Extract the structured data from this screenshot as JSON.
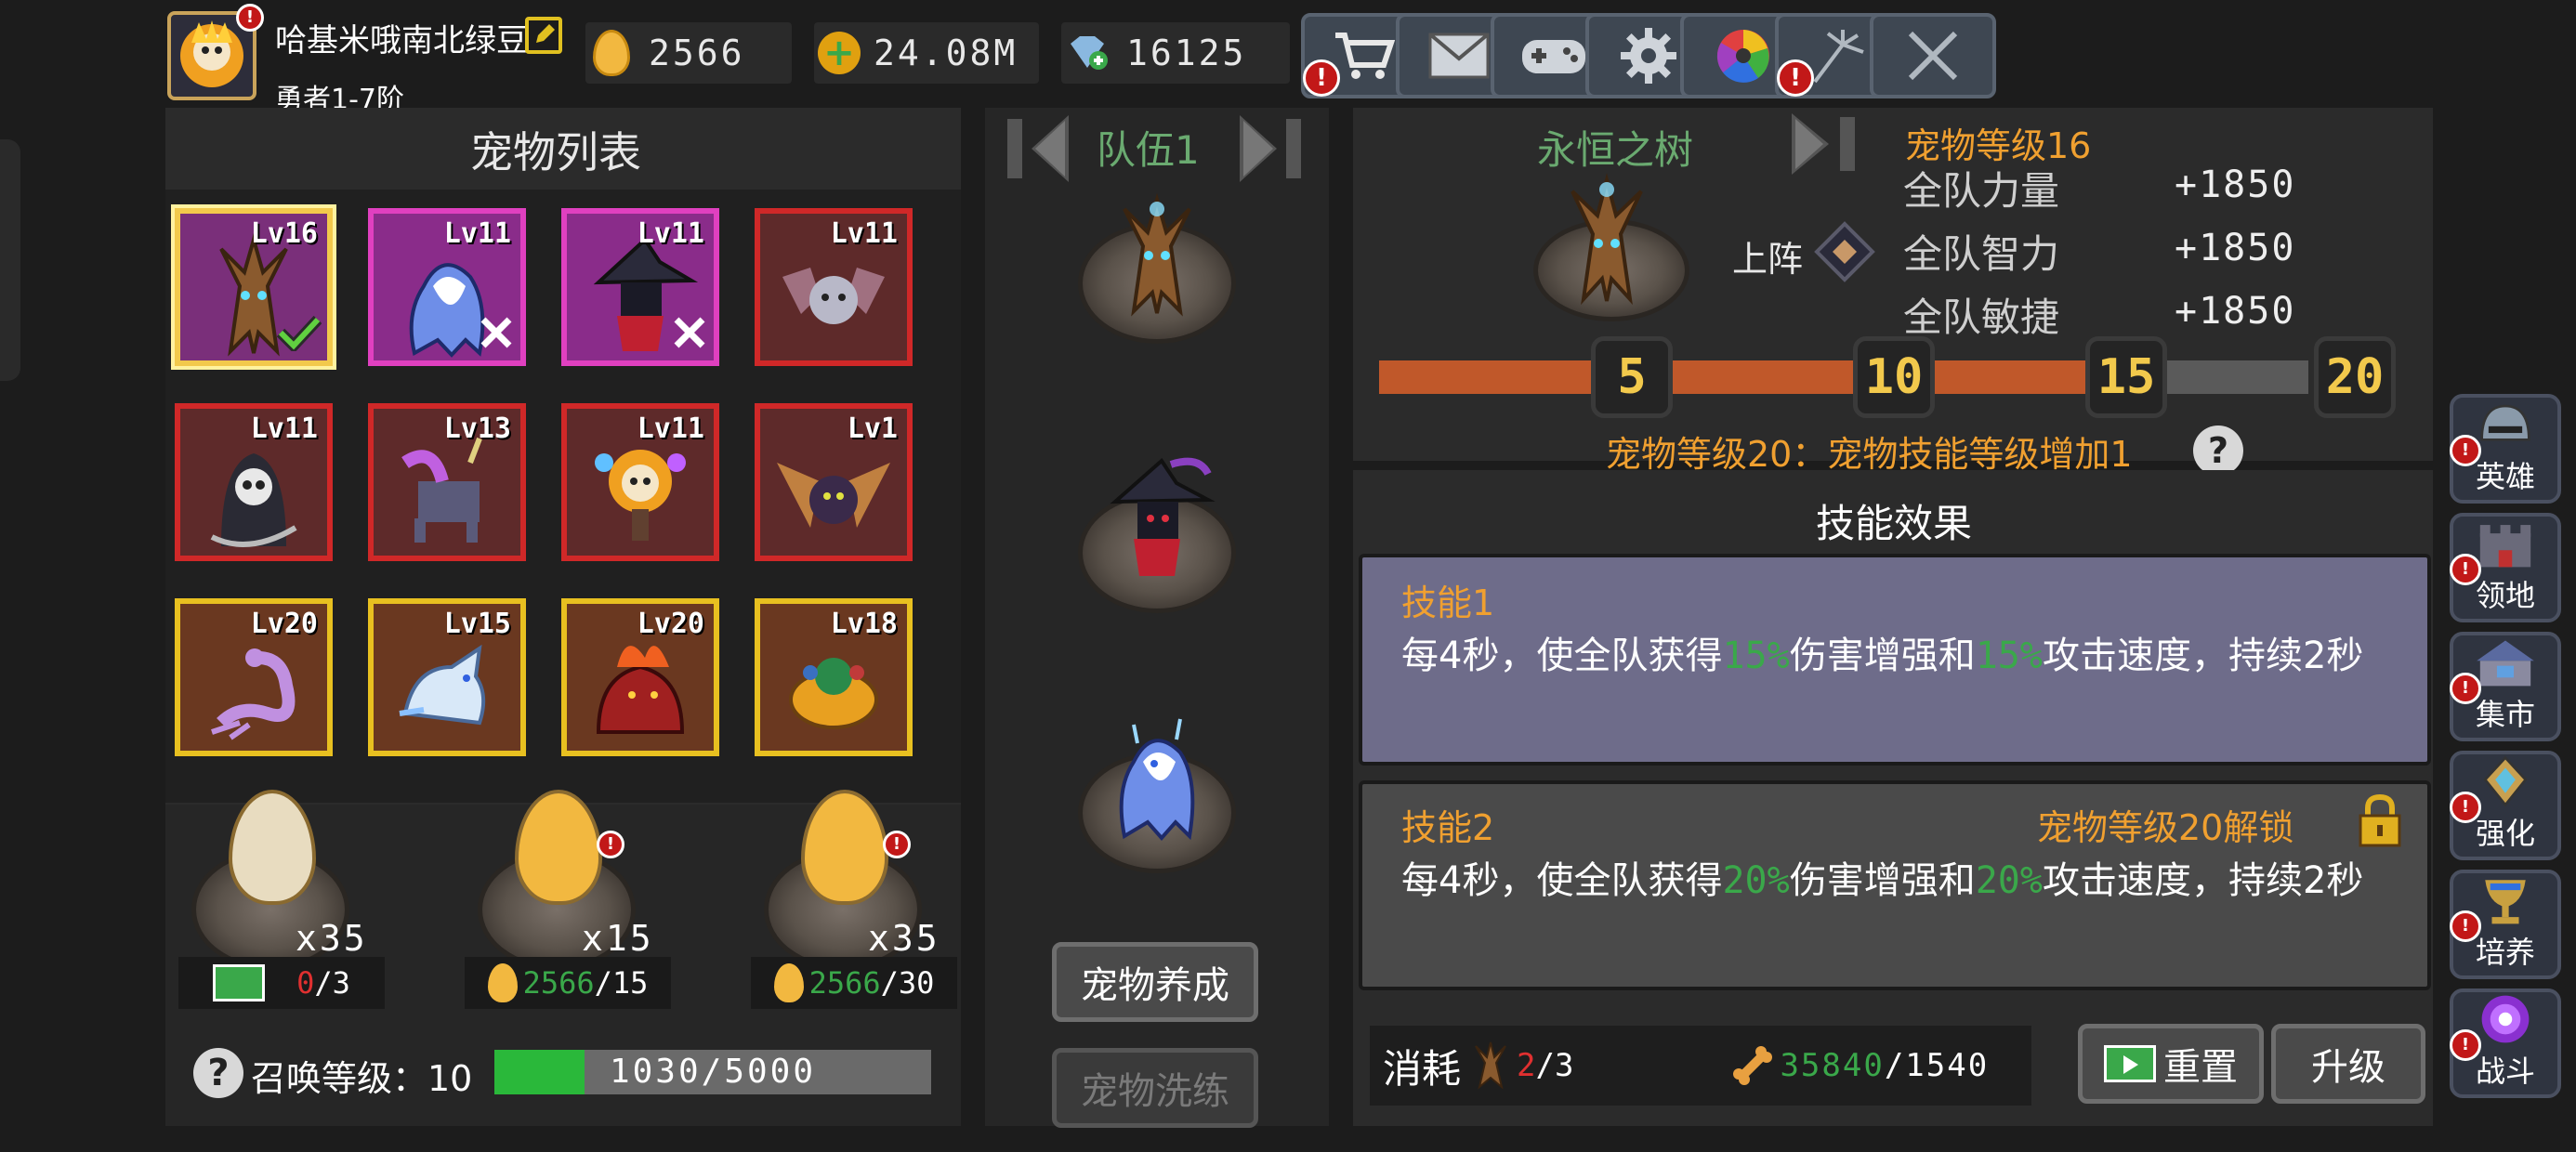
{
  "player": {
    "name": "哈基米哦南北绿豆",
    "rank": "勇者1-7阶",
    "avatar_alert": "!"
  },
  "resources": [
    {
      "name": "gold-egg-icon",
      "value": "2566"
    },
    {
      "name": "coin-plus-icon",
      "value": "24.08M"
    },
    {
      "name": "diamond-plus-icon",
      "value": "16125"
    }
  ],
  "toolbar": [
    {
      "name": "shop-cart-icon",
      "alert": true
    },
    {
      "name": "mail-icon",
      "alert": false
    },
    {
      "name": "gamepad-icon",
      "alert": false
    },
    {
      "name": "gear-icon",
      "alert": false
    },
    {
      "name": "color-wheel-icon",
      "alert": false
    },
    {
      "name": "fireworks-icon",
      "alert": true
    },
    {
      "name": "crossed-swords-icon",
      "alert": false
    }
  ],
  "pet_list": {
    "title": "宠物列表",
    "pets": [
      {
        "lvl": "Lv16",
        "frame": "gold",
        "bg": "#7a2f7a",
        "kind": "tree"
      },
      {
        "lvl": "Lv11",
        "frame": "pink",
        "bg": "#8a2c8a",
        "kind": "ghost"
      },
      {
        "lvl": "Lv11",
        "frame": "pink",
        "bg": "#8a2c8a",
        "kind": "witch"
      },
      {
        "lvl": "Lv11",
        "frame": "red",
        "bg": "#5e2a2a",
        "kind": "bat"
      },
      {
        "lvl": "Lv11",
        "frame": "red",
        "bg": "#5e2a2a",
        "kind": "reaper"
      },
      {
        "lvl": "Lv13",
        "frame": "red",
        "bg": "#5e2a2a",
        "kind": "unicorn"
      },
      {
        "lvl": "Lv11",
        "frame": "red",
        "bg": "#5e2a2a",
        "kind": "skull"
      },
      {
        "lvl": "Lv1",
        "frame": "red",
        "bg": "#5e2a2a",
        "kind": "dragonbat"
      },
      {
        "lvl": "Lv20",
        "frame": "yellow",
        "bg": "#6a3820",
        "kind": "scorpion"
      },
      {
        "lvl": "Lv15",
        "frame": "yellow",
        "bg": "#6a3820",
        "kind": "wolf"
      },
      {
        "lvl": "Lv20",
        "frame": "yellow",
        "bg": "#6a3820",
        "kind": "lava"
      },
      {
        "lvl": "Lv18",
        "frame": "yellow",
        "bg": "#6a3820",
        "kind": "turtle"
      }
    ]
  },
  "summon": {
    "eggs": [
      {
        "count": "x35",
        "cost_have": "0",
        "cost_need": "/3",
        "cost_icon": "ad-video-icon",
        "have_color": "#e03030",
        "alert": false,
        "egg_color": "#e8dcc0"
      },
      {
        "count": "x15",
        "cost_have": "2566",
        "cost_need": "/15",
        "cost_icon": "gold-egg-icon",
        "have_color": "#3aa84a",
        "alert": true,
        "egg_color": "#f2b840"
      },
      {
        "count": "x35",
        "cost_have": "2566",
        "cost_need": "/30",
        "cost_icon": "gold-egg-icon",
        "have_color": "#3aa84a",
        "alert": true,
        "egg_color": "#f2b840"
      }
    ],
    "level_label": "召唤等级：10",
    "progress_text": "1030/5000",
    "progress_fraction": 0.206
  },
  "team": {
    "label": "队伍1",
    "buttons": {
      "nurture": "宠物养成",
      "reroll": "宠物洗练"
    }
  },
  "detail": {
    "pet_name": "永恒之树",
    "deploy_label": "上阵",
    "level_label": "宠物等级16",
    "stats": [
      {
        "name": "全队力量",
        "value": "+1850"
      },
      {
        "name": "全队智力",
        "value": "+1850"
      },
      {
        "name": "全队敏捷",
        "value": "+1850"
      }
    ],
    "milestones": [
      "5",
      "10",
      "15",
      "20"
    ],
    "level_progress": 0.8,
    "milestone_note": "宠物等级20：宠物技能等级增加1",
    "skills_title": "技能效果",
    "skills": [
      {
        "title": "技能1",
        "p1": "每4秒，使全队获得",
        "v1": "15%",
        "p2": "伤害增强和",
        "v2": "15%",
        "p3": "攻击速度，持续2秒",
        "unlock": ""
      },
      {
        "title": "技能2",
        "p1": "每4秒，使全队获得",
        "v1": "20%",
        "p2": "伤害增强和",
        "v2": "20%",
        "p3": "攻击速度，持续2秒",
        "unlock": "宠物等级20解锁"
      }
    ],
    "cost_label": "消耗",
    "cost_pets_have": "2",
    "cost_pets_need": "/3",
    "cost_bones_have": "35840",
    "cost_bones_need": "/1540",
    "reset_label": "重置",
    "upgrade_label": "升级"
  },
  "sidebar": [
    {
      "label": "英雄",
      "icon": "helmet-icon"
    },
    {
      "label": "领地",
      "icon": "castle-icon"
    },
    {
      "label": "集市",
      "icon": "market-icon"
    },
    {
      "label": "强化",
      "icon": "crystal-icon"
    },
    {
      "label": "培养",
      "icon": "chalice-icon"
    },
    {
      "label": "战斗",
      "icon": "portal-icon"
    }
  ],
  "colors": {
    "accent": "#f0a030",
    "progress_orange": "#c0582a",
    "green": "#3aa84a",
    "alert_red": "#c21818"
  }
}
